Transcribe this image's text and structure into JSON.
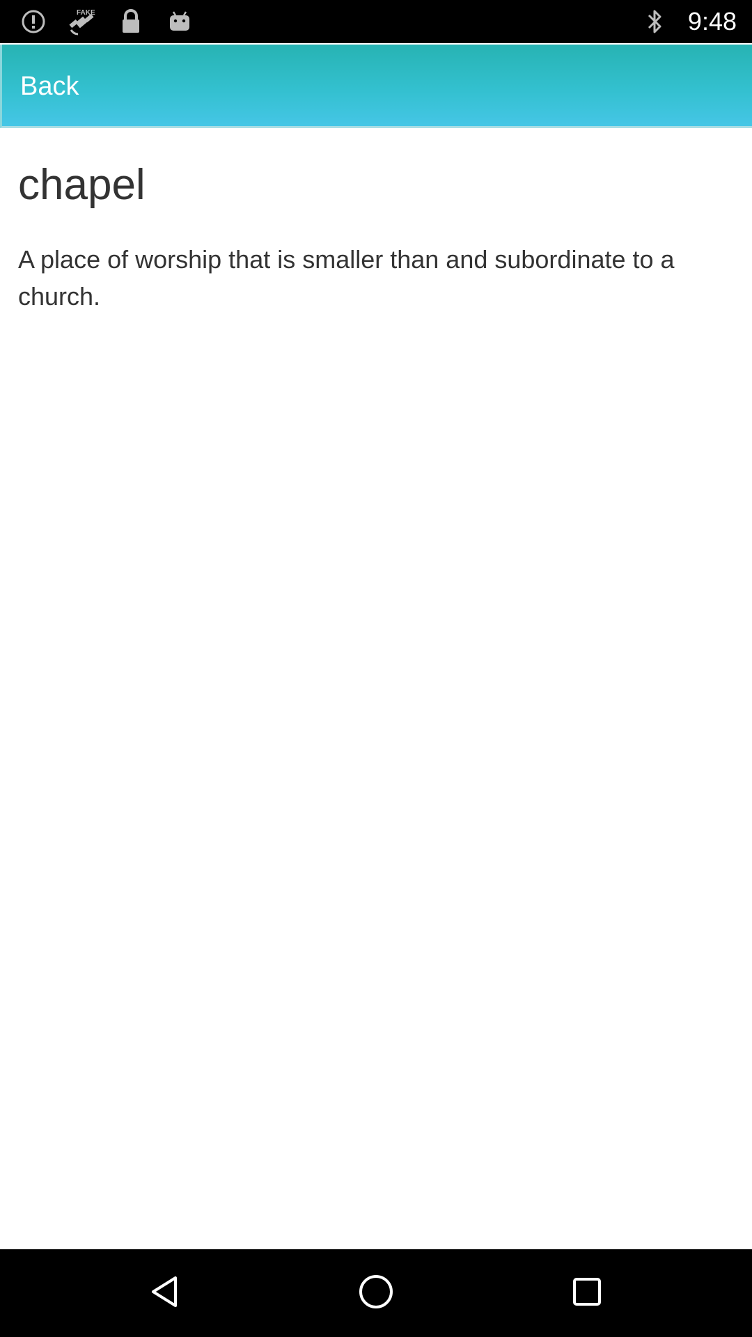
{
  "status_bar": {
    "time": "9:48",
    "left_icons": [
      "alert-circle-icon",
      "fake-gps-satellite-icon",
      "lock-icon",
      "android-icon"
    ],
    "right_icons": [
      "bluetooth-icon"
    ]
  },
  "app_bar": {
    "back_label": "Back",
    "color": "#33c0cf"
  },
  "entry": {
    "word": "chapel",
    "definition": "A place of worship that is smaller than and subordinate to a church."
  },
  "nav_bar": {
    "buttons": [
      "back-triangle-icon",
      "home-circle-icon",
      "recents-square-icon"
    ]
  }
}
